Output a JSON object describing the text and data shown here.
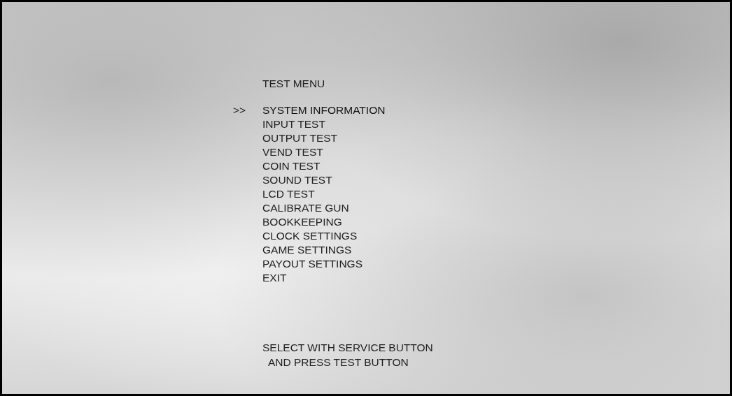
{
  "title": "TEST MENU",
  "cursor": ">>",
  "items": [
    {
      "label": "SYSTEM INFORMATION",
      "selected": true
    },
    {
      "label": "INPUT TEST",
      "selected": false
    },
    {
      "label": "OUTPUT TEST",
      "selected": false
    },
    {
      "label": "VEND TEST",
      "selected": false
    },
    {
      "label": "COIN TEST",
      "selected": false
    },
    {
      "label": "SOUND TEST",
      "selected": false
    },
    {
      "label": "LCD TEST",
      "selected": false
    },
    {
      "label": "CALIBRATE GUN",
      "selected": false
    },
    {
      "label": "BOOKKEEPING",
      "selected": false
    },
    {
      "label": "CLOCK SETTINGS",
      "selected": false
    },
    {
      "label": "GAME SETTINGS",
      "selected": false
    },
    {
      "label": "PAYOUT SETTINGS",
      "selected": false
    },
    {
      "label": "EXIT",
      "selected": false
    }
  ],
  "instructions": [
    "SELECT WITH SERVICE BUTTON",
    "AND PRESS TEST BUTTON"
  ]
}
